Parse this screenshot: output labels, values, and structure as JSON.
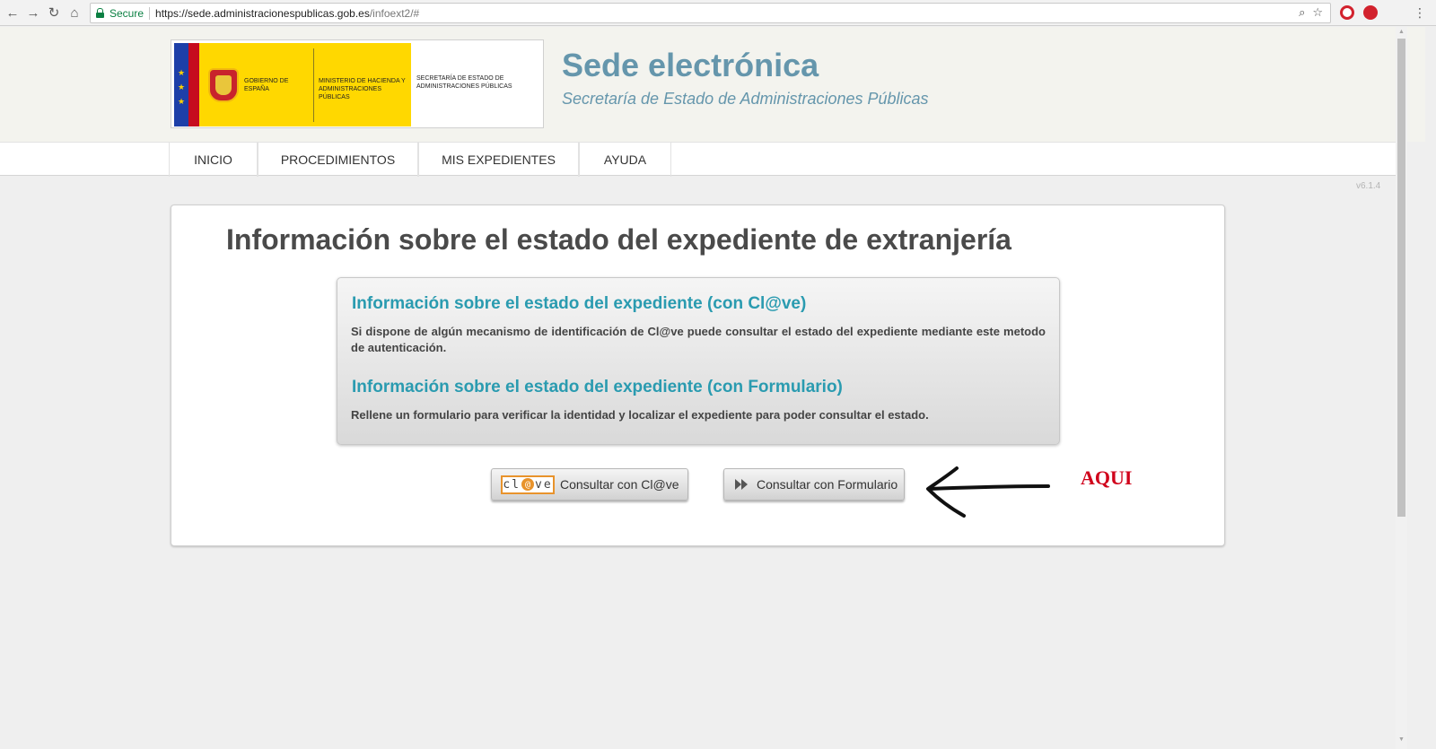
{
  "browser": {
    "secure_label": "Secure",
    "url_host": "https://sede.administracionespublicas.gob.es",
    "url_path": "/infoext2/#"
  },
  "logo": {
    "gobierno": "GOBIERNO DE ESPAÑA",
    "ministerio": "MINISTERIO DE HACIENDA Y ADMINISTRACIONES PÚBLICAS",
    "secretaria": "SECRETARÍA DE ESTADO DE ADMINISTRACIONES PÚBLICAS"
  },
  "header": {
    "title": "Sede electrónica",
    "subtitle": "Secretaría de Estado de Administraciones Públicas"
  },
  "nav": {
    "items": [
      "INICIO",
      "PROCEDIMIENTOS",
      "MIS EXPEDIENTES",
      "AYUDA"
    ]
  },
  "version": "v6.1.4",
  "main": {
    "heading": "Información sobre el estado del expediente de extranjería",
    "sections": [
      {
        "title": "Información sobre el estado del expediente (con Cl@ve)",
        "text": "Si dispone de algún mecanismo de identificación de Cl@ve puede consultar el estado del expediente mediante este metodo de autenticación."
      },
      {
        "title": "Información sobre el estado del expediente (con Formulario)",
        "text": "Rellene un formulario para verificar la identidad y localizar el expediente para poder consultar el estado."
      }
    ],
    "buttons": {
      "clave": "Consultar con Cl@ve",
      "formulario": "Consultar con Formulario"
    }
  },
  "annotation": {
    "text": "AQUI"
  },
  "colors": {
    "accent": "#6596ac",
    "section_title": "#2a9bb0",
    "annotation": "#d0021b"
  }
}
